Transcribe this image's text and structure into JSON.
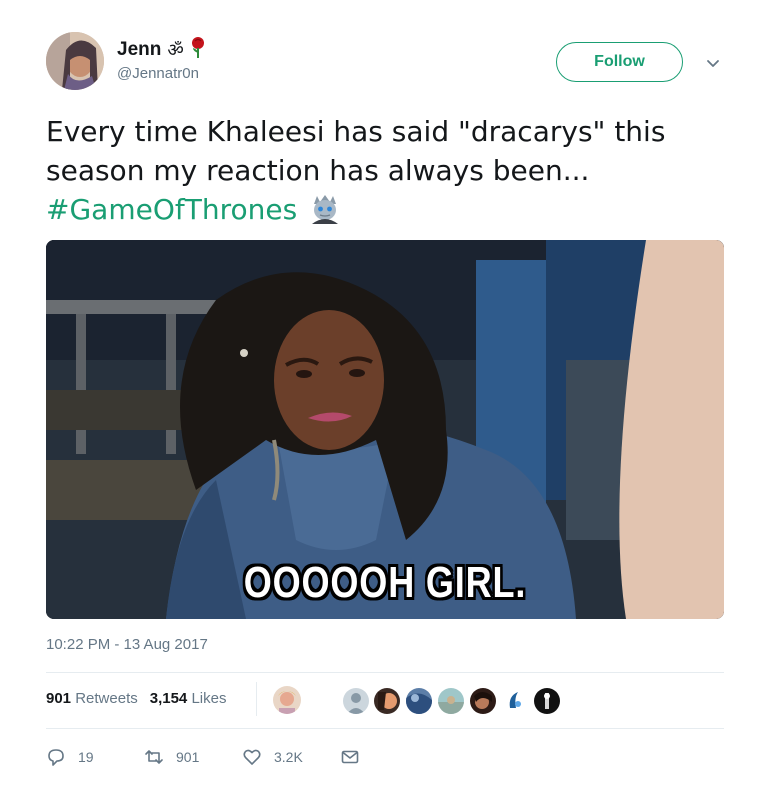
{
  "tweet": {
    "author": {
      "display_name": "Jenn",
      "name_emoji_1": "ॐ",
      "name_emoji_2": "🌹",
      "handle": "@Jennatr0n",
      "avatar": "avatar-photo"
    },
    "follow_label": "Follow",
    "text_line": "Every time Khaleesi has said \"dracarys\" this season my reaction has always been...",
    "hashtag": "#GameOfThrones",
    "hashtag_emoji": "night-king-icon",
    "media": {
      "caption": "OOOOOH GIRL.",
      "type": "gif"
    },
    "timestamp": "10:22 PM - 13 Aug 2017",
    "stats": {
      "retweets_count": "901",
      "retweets_label": "Retweets",
      "likes_count": "3,154",
      "likes_label": "Likes"
    },
    "actions": {
      "reply_count": "19",
      "retweet_count": "901",
      "like_count": "3.2K"
    },
    "colors": {
      "accent": "#1a9e73",
      "muted": "#657786",
      "text": "#14171a"
    }
  }
}
